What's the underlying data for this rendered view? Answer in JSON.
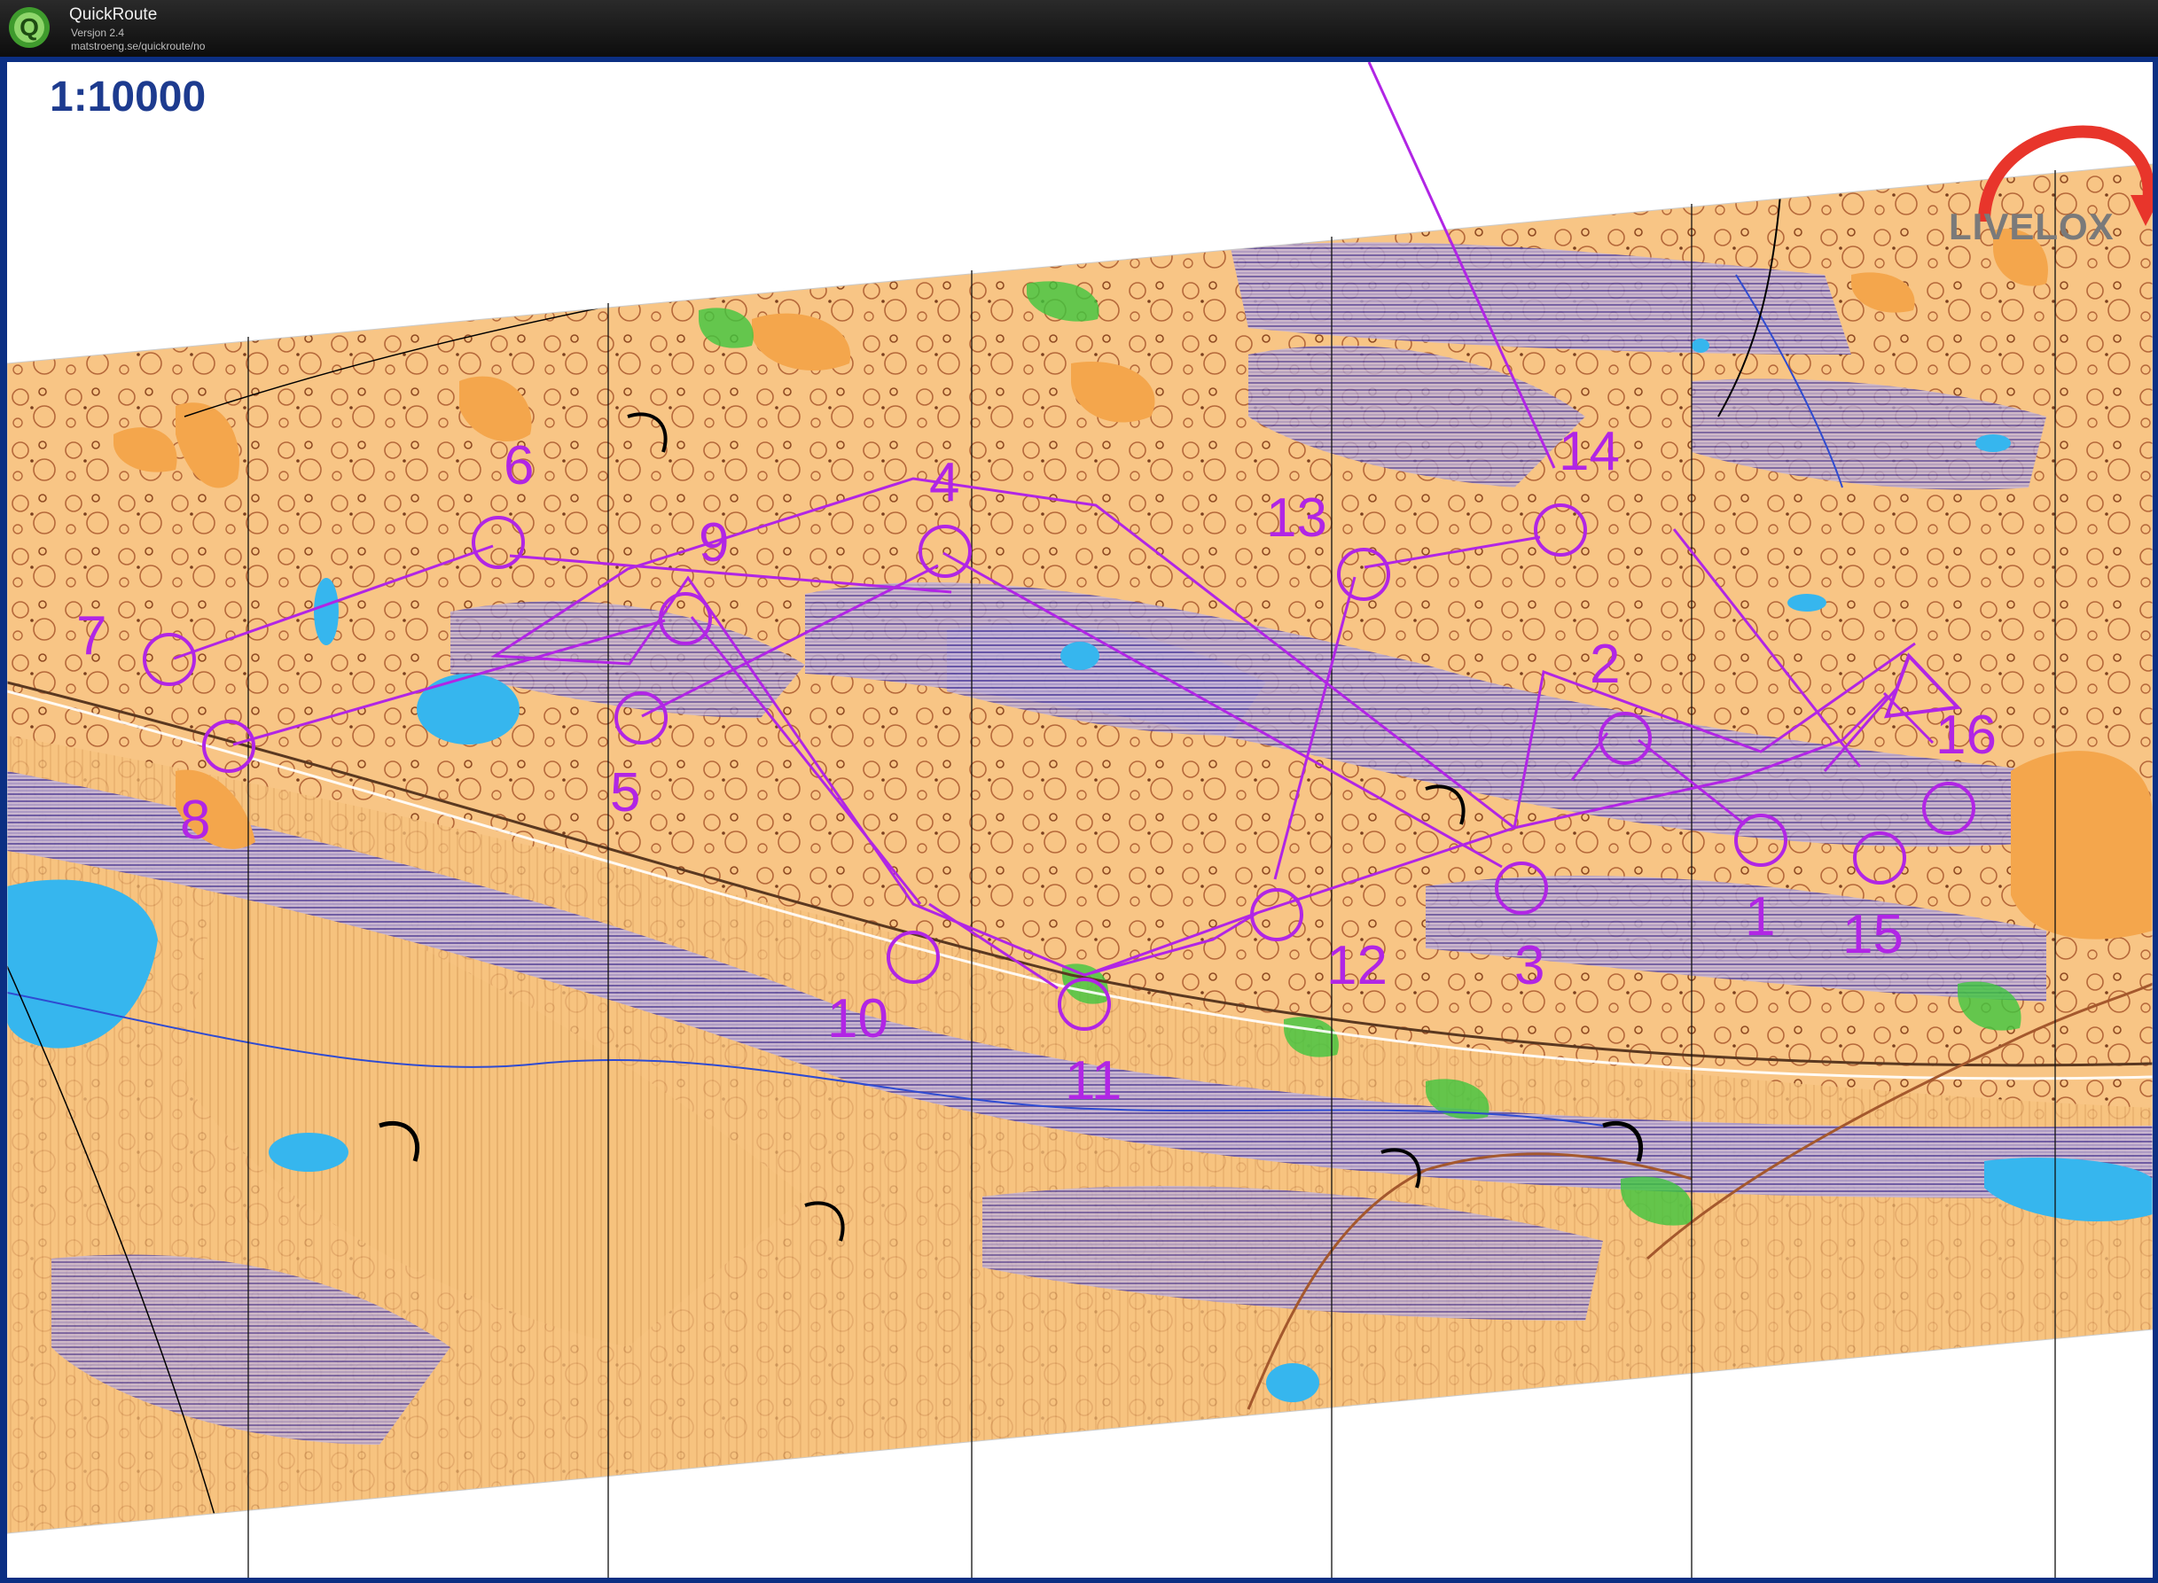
{
  "app": {
    "name": "QuickRoute",
    "version": "Versjon 2.4",
    "url": "matstroeng.se/quickroute/no",
    "logo_letter": "Q"
  },
  "map": {
    "scale": "1:10000",
    "brand": "LIVELOX",
    "course_color": "#b125e5",
    "terrain_colors": {
      "open": "#f9c888",
      "open_dark": "#f4a64c",
      "marsh": "#9a8bc0",
      "water": "#36b6ee",
      "green": "#3ec63e",
      "contour": "#a4582d"
    }
  },
  "controls": [
    {
      "label": "1"
    },
    {
      "label": "2"
    },
    {
      "label": "3"
    },
    {
      "label": "4"
    },
    {
      "label": "5"
    },
    {
      "label": "6"
    },
    {
      "label": "7"
    },
    {
      "label": "8"
    },
    {
      "label": "9"
    },
    {
      "label": "10"
    },
    {
      "label": "11"
    },
    {
      "label": "12"
    },
    {
      "label": "13"
    },
    {
      "label": "14"
    },
    {
      "label": "15"
    },
    {
      "label": "16"
    }
  ]
}
